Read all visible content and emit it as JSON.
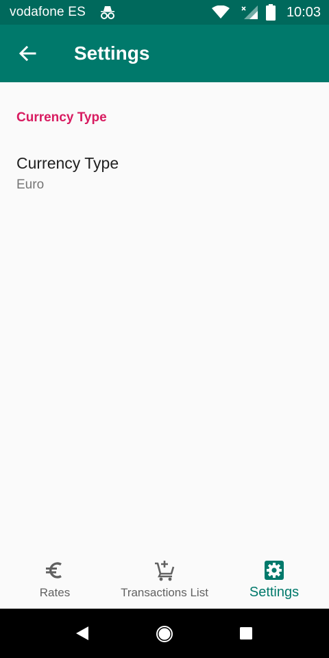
{
  "status_bar": {
    "carrier": "vodafone ES",
    "time": "10:03",
    "icons": [
      "incognito-icon",
      "wifi-icon",
      "signal-icon",
      "battery-icon"
    ]
  },
  "app_bar": {
    "title": "Settings",
    "back_icon": "arrow-back-icon"
  },
  "preferences": {
    "category_title": "Currency Type",
    "items": [
      {
        "title": "Currency Type",
        "summary": "Euro"
      }
    ]
  },
  "bottom_nav": {
    "items": [
      {
        "label": "Rates",
        "icon": "euro-icon",
        "active": false
      },
      {
        "label": "Transactions List",
        "icon": "cart-add-icon",
        "active": false
      },
      {
        "label": "Settings",
        "icon": "settings-gear-icon",
        "active": true
      }
    ]
  },
  "colors": {
    "status_bar": "#00695c",
    "app_bar": "#00796b",
    "accent": "#d81b60",
    "active_nav": "#00796b",
    "inactive_nav": "#616161"
  },
  "system_nav": {
    "buttons": [
      "nav-back-icon",
      "nav-home-icon",
      "nav-recent-icon"
    ]
  }
}
